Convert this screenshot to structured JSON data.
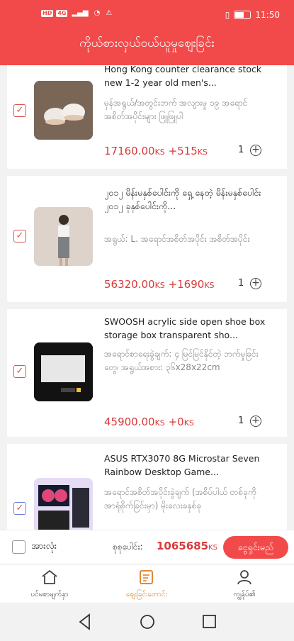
{
  "status": {
    "time": "11:50",
    "left_badges": [
      "HD",
      "4G"
    ]
  },
  "header": {
    "title": "ကိုယ်စားလှယ်ဝယ်ယူမှုစျေးခြင်း"
  },
  "items": [
    {
      "title": "Hong Kong counter clearance stock new 1-2 year old men's...",
      "spec": "မှန်အရွယ်/အတွင်းဘက် အလျားမှု ၁၉ အရောင် အစိတ်အပိုင်းများ ဖြူဖြူပါ",
      "price": "17160.00",
      "price_unit": "KS",
      "shipping": "+515",
      "shipping_unit": "KS",
      "qty": "1",
      "checked": true
    },
    {
      "title": "၂၀၁၂ မိန်းမနှစ်ပေါင်းကို ရှေ့ နေတဲ့ မိန်းမနှစ်ပေါင်း ၂၀၁၂ ခုနှစ်ပေါင်းကို...",
      "spec": "အရွယ်: L. အရောင်အစိတ်အပိုင်း အစိတ်အပိုင်း",
      "price": "56320.00",
      "price_unit": "KS",
      "shipping": "+1690",
      "shipping_unit": "KS",
      "qty": "1",
      "checked": true
    },
    {
      "title": "SWOOSH acrylic side open shoe box storage box transparent sho...",
      "spec": "အရောင်စာရေးခွဲချက်: ၄ မြင်မြင်နိုင်တဲ့ ဘက်မှုခြင်းတွေ၊ အရွယ်အစား: ၃၆x28x22cm",
      "price": "45900.00",
      "price_unit": "KS",
      "shipping": "+0",
      "shipping_unit": "KS",
      "qty": "1",
      "checked": true
    },
    {
      "title": "ASUS RTX3070 8G Microstar Seven Rainbow Desktop Game...",
      "spec": "အရောင်အစိတ်အပိုင်းခွဲချက် (အစိပ်ပါယ် တစ်ခုကို အာရုံစိုက်ခြင်းမှာ) မိုးလေးခနှစ်ခု",
      "checked": true
    }
  ],
  "bottom": {
    "select_all": "အားလုံး",
    "total_label": "စုစုပေါင်း:",
    "total": "1065685",
    "total_unit": "KS",
    "checkout": "ငွေရှင်းမည်"
  },
  "tabs": [
    {
      "label": "ပင်မစာမျက်နှာ"
    },
    {
      "label": "စျေးခြင်းတောင်း"
    },
    {
      "label": "ကျွန်ုပ်၏"
    }
  ],
  "colors": {
    "accent": "#f24a4a",
    "price": "#d83a3a",
    "active_tab": "#e07a1f"
  }
}
